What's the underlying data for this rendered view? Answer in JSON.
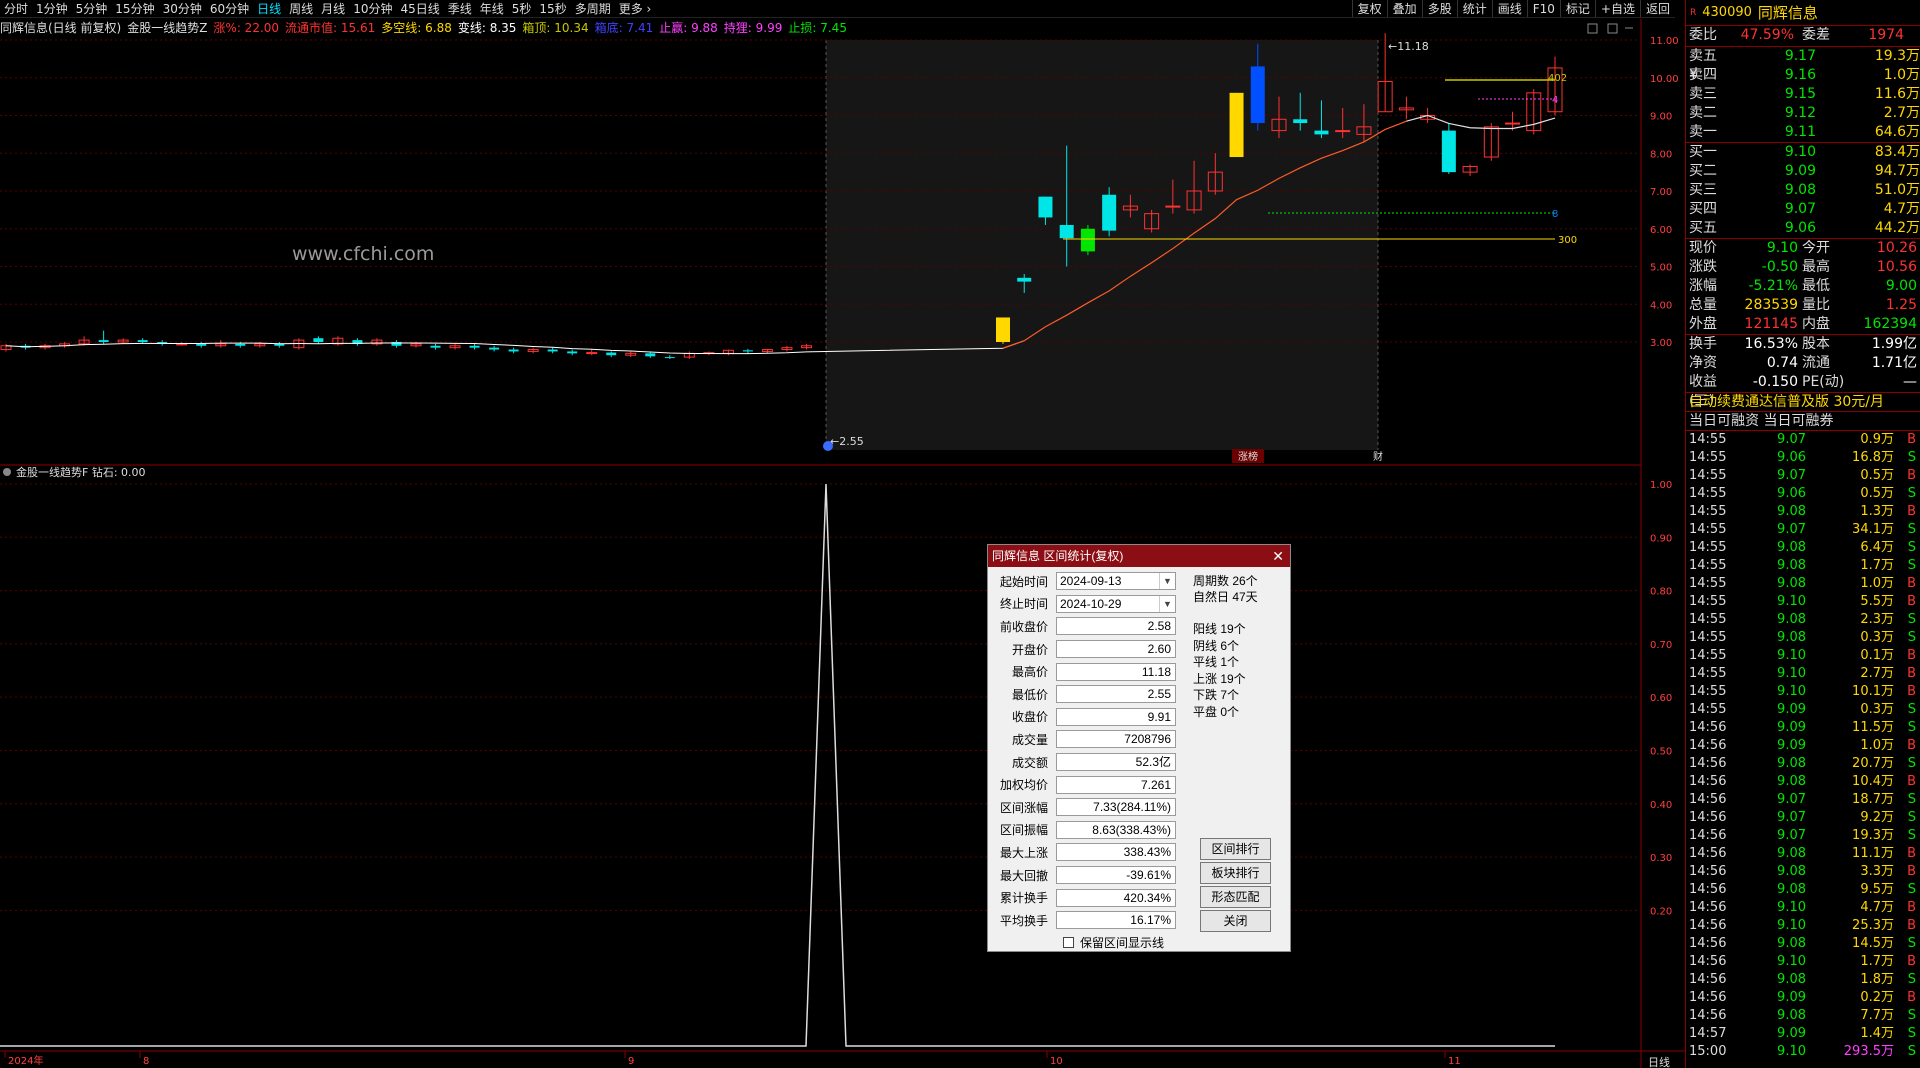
{
  "toolbar": {
    "periods": [
      "分时",
      "1分钟",
      "5分钟",
      "15分钟",
      "30分钟",
      "60分钟",
      "日线",
      "周线",
      "月线",
      "10分钟",
      "45日线",
      "季线",
      "年线",
      "5秒",
      "15秒",
      "多周期",
      "更多 ›"
    ],
    "active_period": "日线",
    "tools": [
      "复权",
      "叠加",
      "多股",
      "统计",
      "画线",
      "F10",
      "标记",
      "+自选",
      "返回"
    ]
  },
  "infobar": {
    "stock_label": "同辉信息(日线 前复权)",
    "indicator": "金股一线趋势Z",
    "items": [
      {
        "text": "涨%: 22.00",
        "color": "#ff3232"
      },
      {
        "text": "流通市值: 15.61",
        "color": "#ff3232"
      },
      {
        "text": "多空线: 6.88",
        "color": "#ffd800"
      },
      {
        "text": "变线: 8.35",
        "color": "#ffffff"
      },
      {
        "text": "箱顶: 10.34",
        "color": "#c8c800"
      },
      {
        "text": "箱底: 7.41",
        "color": "#4040ff"
      },
      {
        "text": "止赢: 9.88",
        "color": "#ff40ff"
      },
      {
        "text": "持狸: 9.99",
        "color": "#ff40ff"
      },
      {
        "text": "止损: 7.45",
        "color": "#00e600"
      }
    ]
  },
  "watermark": "www.cfchi.com",
  "main_axis": {
    "ticks": [
      "11.00",
      "10.00",
      "9.00",
      "8.00",
      "7.00",
      "6.00",
      "5.00",
      "4.00",
      "3.00"
    ]
  },
  "sub_axis": {
    "ticks": [
      "1.00",
      "0.90",
      "0.80",
      "0.70",
      "0.60",
      "0.50",
      "0.40",
      "0.30",
      "0.20"
    ]
  },
  "sub_indicator": {
    "label": "金股一线趋势F",
    "value_text": "钻石: 0.00"
  },
  "date_axis": [
    "2024年",
    "8",
    "9",
    "10",
    "11"
  ],
  "period_label": "日线",
  "chart_marks": {
    "high": "11.18",
    "low": "2.55",
    "line_300": "300",
    "line_402": "402",
    "line_4": "4",
    "line_8": "8",
    "tag_up": "涨榜",
    "tag_cai": "财"
  },
  "chart_data": {
    "type": "candlestick",
    "note_series": "daily K-line, 前复权",
    "candles": [
      [
        2.8,
        2.9,
        2.75,
        2.95
      ],
      [
        2.9,
        2.85,
        2.8,
        2.95
      ],
      [
        2.85,
        2.9,
        2.8,
        2.95
      ],
      [
        2.9,
        2.95,
        2.85,
        3.0
      ],
      [
        2.95,
        3.05,
        2.9,
        3.15
      ],
      [
        3.05,
        3.0,
        2.95,
        3.3
      ],
      [
        3.0,
        3.05,
        2.95,
        3.1
      ],
      [
        3.05,
        3.0,
        2.95,
        3.1
      ],
      [
        3.0,
        2.95,
        2.9,
        3.05
      ],
      [
        2.95,
        2.95,
        2.9,
        3.0
      ],
      [
        2.95,
        2.9,
        2.85,
        3.0
      ],
      [
        2.9,
        2.95,
        2.85,
        3.05
      ],
      [
        2.95,
        2.9,
        2.85,
        3.0
      ],
      [
        2.9,
        2.95,
        2.85,
        3.0
      ],
      [
        2.95,
        2.9,
        2.85,
        3.0
      ],
      [
        2.85,
        3.05,
        2.8,
        3.1
      ],
      [
        3.1,
        3.0,
        2.95,
        3.15
      ],
      [
        2.95,
        3.1,
        2.9,
        3.15
      ],
      [
        3.05,
        2.95,
        2.9,
        3.1
      ],
      [
        2.95,
        3.05,
        2.9,
        3.1
      ],
      [
        3.0,
        2.9,
        2.85,
        3.05
      ],
      [
        2.9,
        2.95,
        2.85,
        3.0
      ],
      [
        2.9,
        2.85,
        2.8,
        2.95
      ],
      [
        2.85,
        2.9,
        2.8,
        2.95
      ],
      [
        2.9,
        2.85,
        2.8,
        2.95
      ],
      [
        2.85,
        2.8,
        2.75,
        2.9
      ],
      [
        2.8,
        2.75,
        2.7,
        2.85
      ],
      [
        2.75,
        2.8,
        2.7,
        2.85
      ],
      [
        2.8,
        2.75,
        2.7,
        2.85
      ],
      [
        2.75,
        2.7,
        2.65,
        2.8
      ],
      [
        2.7,
        2.72,
        2.65,
        2.8
      ],
      [
        2.72,
        2.65,
        2.6,
        2.75
      ],
      [
        2.65,
        2.7,
        2.6,
        2.75
      ],
      [
        2.7,
        2.62,
        2.58,
        2.75
      ],
      [
        2.6,
        2.58,
        2.55,
        2.65
      ],
      [
        2.6,
        2.7,
        2.55,
        2.75
      ],
      [
        2.7,
        2.72,
        2.65,
        2.75
      ],
      [
        2.7,
        2.78,
        2.65,
        2.8
      ],
      [
        2.78,
        2.75,
        2.7,
        2.82
      ],
      [
        2.75,
        2.8,
        2.7,
        2.82
      ],
      [
        2.8,
        2.85,
        2.75,
        2.9
      ],
      [
        2.85,
        2.9,
        2.8,
        2.95
      ],
      [
        3.0,
        3.65,
        2.95,
        3.65
      ],
      [
        4.7,
        4.6,
        4.3,
        4.8
      ],
      [
        6.85,
        6.3,
        6.1,
        6.85
      ],
      [
        6.1,
        5.75,
        5.0,
        8.2
      ],
      [
        5.4,
        6.0,
        5.3,
        6.1
      ],
      [
        6.9,
        5.95,
        5.8,
        7.1
      ],
      [
        6.5,
        6.6,
        6.3,
        6.9
      ],
      [
        6.0,
        6.4,
        5.9,
        6.5
      ],
      [
        6.6,
        6.6,
        6.4,
        7.3
      ],
      [
        6.5,
        7.0,
        6.4,
        7.8
      ],
      [
        7.0,
        7.5,
        6.9,
        8.0
      ],
      [
        7.9,
        9.6,
        7.9,
        9.6
      ],
      [
        10.3,
        8.8,
        8.6,
        10.9
      ],
      [
        8.6,
        8.9,
        8.4,
        9.5
      ],
      [
        8.9,
        8.8,
        8.6,
        9.6
      ],
      [
        8.6,
        8.5,
        8.4,
        9.4
      ],
      [
        8.6,
        8.6,
        8.4,
        9.2
      ],
      [
        8.5,
        8.7,
        8.3,
        9.3
      ],
      [
        9.1,
        9.9,
        9.1,
        11.18
      ],
      [
        9.15,
        9.2,
        8.9,
        9.5
      ],
      [
        8.9,
        9.0,
        8.8,
        9.2
      ],
      [
        8.6,
        7.5,
        7.45,
        8.8
      ],
      [
        7.5,
        7.65,
        7.4,
        7.7
      ],
      [
        7.9,
        8.7,
        7.8,
        8.8
      ],
      [
        8.8,
        8.8,
        8.6,
        9.1
      ],
      [
        8.6,
        9.6,
        8.5,
        9.7
      ],
      [
        9.1,
        10.26,
        9.0,
        10.56
      ]
    ]
  },
  "quote": {
    "code": "430090",
    "name": "同辉信息",
    "weibi": {
      "label": "委比",
      "value": "47.59%",
      "label2": "委差",
      "value2": "1974"
    },
    "sell": [
      {
        "label": "卖五 ¥",
        "price": "9.17",
        "vol": "19.3万"
      },
      {
        "label": "卖四",
        "price": "9.16",
        "vol": "1.0万"
      },
      {
        "label": "卖三",
        "price": "9.15",
        "vol": "11.6万"
      },
      {
        "label": "卖二",
        "price": "9.12",
        "vol": "2.7万"
      },
      {
        "label": "卖一",
        "price": "9.11",
        "vol": "64.6万"
      }
    ],
    "buy": [
      {
        "label": "买一",
        "price": "9.10",
        "vol": "83.4万"
      },
      {
        "label": "买二",
        "price": "9.09",
        "vol": "94.7万"
      },
      {
        "label": "买三",
        "price": "9.08",
        "vol": "51.0万"
      },
      {
        "label": "买四",
        "price": "9.07",
        "vol": "4.7万"
      },
      {
        "label": "买五",
        "price": "9.06",
        "vol": "44.2万"
      }
    ],
    "stats1": [
      {
        "l": "现价",
        "v": "9.10",
        "vc": "#00e600",
        "l2": "今开",
        "v2": "10.26",
        "v2c": "#ff3232"
      },
      {
        "l": "涨跌",
        "v": "-0.50",
        "vc": "#00e600",
        "l2": "最高",
        "v2": "10.56",
        "v2c": "#ff3232"
      },
      {
        "l": "涨幅",
        "v": "-5.21%",
        "vc": "#00e600",
        "l2": "最低",
        "v2": "9.00",
        "v2c": "#00e600"
      },
      {
        "l": "总量",
        "v": "283539",
        "vc": "#ffd800",
        "l2": "量比",
        "v2": "1.25",
        "v2c": "#ff3232"
      },
      {
        "l": "外盘",
        "v": "121145",
        "vc": "#ff3232",
        "l2": "内盘",
        "v2": "162394",
        "v2c": "#00e600"
      }
    ],
    "stats2": [
      {
        "l": "换手",
        "v": "16.53%",
        "l2": "股本",
        "v2": "1.99亿"
      },
      {
        "l": "净资",
        "v": "0.74",
        "l2": "流通",
        "v2": "1.71亿"
      },
      {
        "l": "收益(三)",
        "v": "-0.150",
        "l2": "PE(动)",
        "v2": "—"
      }
    ],
    "ad": "自动续费通达信普及版 30元/月",
    "margin": "当日可融资 当日可融券",
    "ticks": [
      [
        "14:55",
        "9.07",
        "0.9万",
        "B"
      ],
      [
        "14:55",
        "9.06",
        "16.8万",
        "S"
      ],
      [
        "14:55",
        "9.07",
        "0.5万",
        "B"
      ],
      [
        "14:55",
        "9.06",
        "0.5万",
        "S"
      ],
      [
        "14:55",
        "9.08",
        "1.3万",
        "B"
      ],
      [
        "14:55",
        "9.07",
        "34.1万",
        "S"
      ],
      [
        "14:55",
        "9.08",
        "6.4万",
        "S"
      ],
      [
        "14:55",
        "9.08",
        "1.7万",
        "S"
      ],
      [
        "14:55",
        "9.08",
        "1.0万",
        "B"
      ],
      [
        "14:55",
        "9.10",
        "5.5万",
        "B"
      ],
      [
        "14:55",
        "9.08",
        "2.3万",
        "S"
      ],
      [
        "14:55",
        "9.08",
        "0.3万",
        "S"
      ],
      [
        "14:55",
        "9.10",
        "0.1万",
        "B"
      ],
      [
        "14:55",
        "9.10",
        "2.7万",
        "B"
      ],
      [
        "14:55",
        "9.10",
        "10.1万",
        "B"
      ],
      [
        "14:55",
        "9.09",
        "0.3万",
        "S"
      ],
      [
        "14:56",
        "9.09",
        "11.5万",
        "S"
      ],
      [
        "14:56",
        "9.09",
        "1.0万",
        "B"
      ],
      [
        "14:56",
        "9.08",
        "20.7万",
        "S"
      ],
      [
        "14:56",
        "9.08",
        "10.4万",
        "B"
      ],
      [
        "14:56",
        "9.07",
        "18.7万",
        "S"
      ],
      [
        "14:56",
        "9.07",
        "9.2万",
        "S"
      ],
      [
        "14:56",
        "9.07",
        "19.3万",
        "S"
      ],
      [
        "14:56",
        "9.08",
        "11.1万",
        "B"
      ],
      [
        "14:56",
        "9.08",
        "3.3万",
        "B"
      ],
      [
        "14:56",
        "9.08",
        "9.5万",
        "S"
      ],
      [
        "14:56",
        "9.10",
        "4.7万",
        "B"
      ],
      [
        "14:56",
        "9.10",
        "25.3万",
        "B"
      ],
      [
        "14:56",
        "9.08",
        "14.5万",
        "S"
      ],
      [
        "14:56",
        "9.10",
        "1.7万",
        "B"
      ],
      [
        "14:56",
        "9.08",
        "1.8万",
        "S"
      ],
      [
        "14:56",
        "9.09",
        "0.2万",
        "B"
      ],
      [
        "14:56",
        "9.08",
        "7.7万",
        "S"
      ],
      [
        "14:57",
        "9.09",
        "1.4万",
        "S"
      ],
      [
        "15:00",
        "9.10",
        "293.5万",
        "S"
      ]
    ]
  },
  "dialog": {
    "title": "同辉信息 区间统计(复权)",
    "start_label": "起始时间",
    "start_value": "2024-09-13",
    "end_label": "终止时间",
    "end_value": "2024-10-29",
    "fields": [
      {
        "label": "前收盘价",
        "value": "2.58"
      },
      {
        "label": "开盘价",
        "value": "2.60"
      },
      {
        "label": "最高价",
        "value": "11.18"
      },
      {
        "label": "最低价",
        "value": "2.55"
      },
      {
        "label": "收盘价",
        "value": "9.91"
      },
      {
        "label": "成交量",
        "value": "7208796"
      },
      {
        "label": "成交额",
        "value": "52.3亿"
      },
      {
        "label": "加权均价",
        "value": "7.261"
      },
      {
        "label": "区间涨幅",
        "value": "7.33(284.11%)"
      },
      {
        "label": "区间振幅",
        "value": "8.63(338.43%)"
      },
      {
        "label": "最大上涨",
        "value": "338.43%"
      },
      {
        "label": "最大回撤",
        "value": "-39.61%"
      },
      {
        "label": "累计换手",
        "value": "420.34%"
      },
      {
        "label": "平均换手",
        "value": "16.17%"
      }
    ],
    "stats_a": [
      "周期数 26个",
      "自然日 47天"
    ],
    "stats_b": [
      "阳线 19个",
      "阴线 6个",
      "平线 1个",
      "上涨 19个",
      "下跌 7个",
      "平盘 0个"
    ],
    "buttons": [
      "区间排行",
      "板块排行",
      "形态匹配",
      "关闭"
    ],
    "checkbox": "保留区间显示线"
  }
}
